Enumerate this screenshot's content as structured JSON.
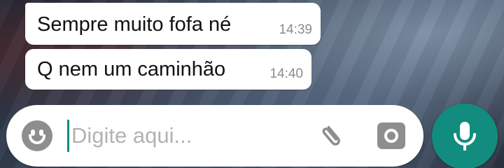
{
  "messages": [
    {
      "text": "Sempre muito fofa né",
      "time": "14:39"
    },
    {
      "text": "Q nem um caminhão",
      "time": "14:40"
    }
  ],
  "composer": {
    "placeholder": "Digite aqui...",
    "value": ""
  },
  "icons": {
    "emoji": "emoji-icon",
    "attach": "paperclip-icon",
    "camera": "camera-icon",
    "mic": "microphone-icon"
  },
  "colors": {
    "accent": "#128c7e",
    "bubble": "#ffffff",
    "timestamp": "#8c8c8c",
    "icon_gray": "#8e8e8e"
  }
}
